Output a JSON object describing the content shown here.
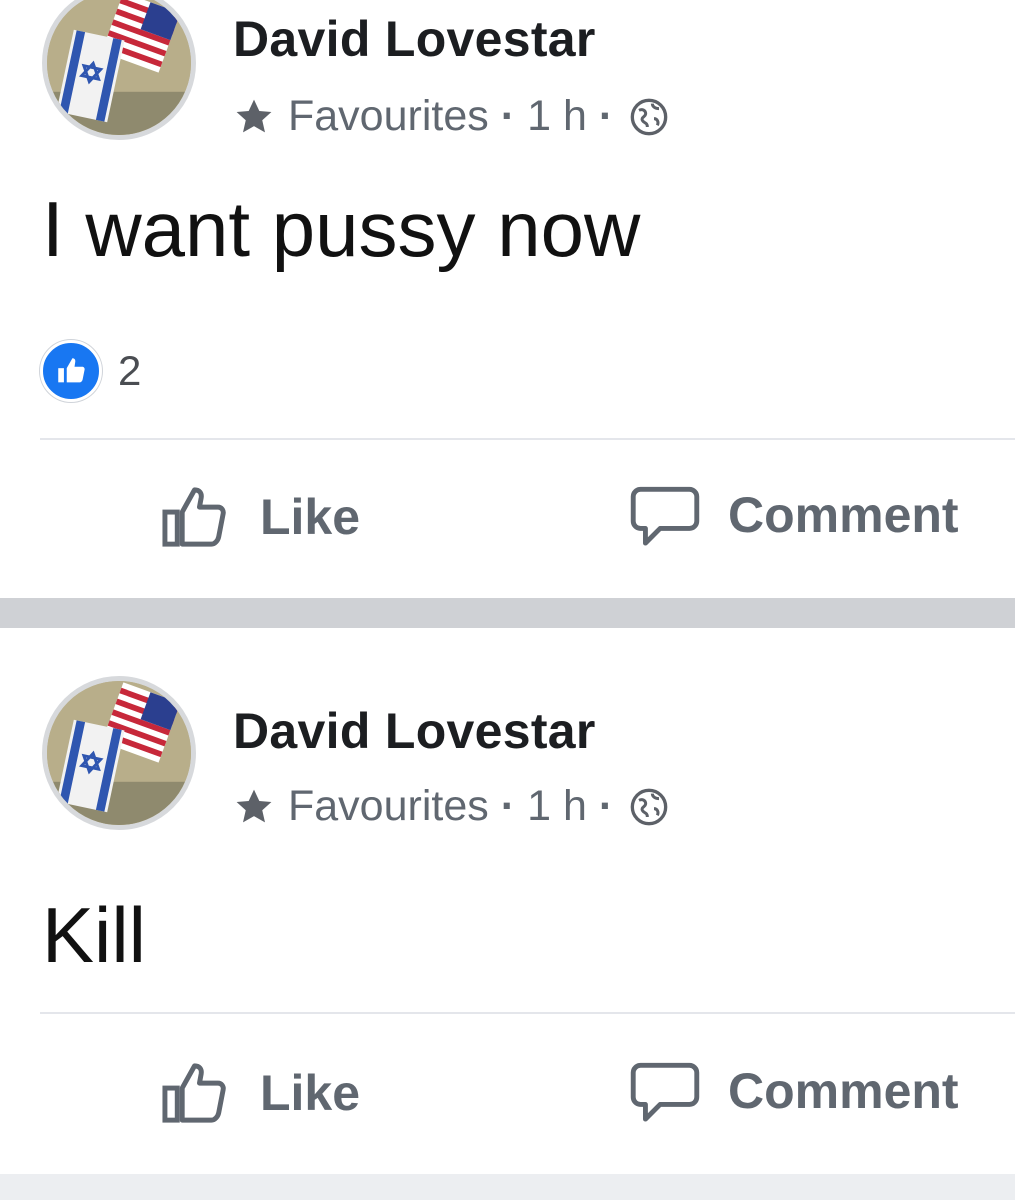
{
  "posts": [
    {
      "author": "David Lovestar",
      "audience": "Favourites",
      "separator": "·",
      "time": "1 h",
      "text": "I want pussy now",
      "reaction_count": "2",
      "actions": {
        "like": "Like",
        "comment": "Comment"
      }
    },
    {
      "author": "David Lovestar",
      "audience": "Favourites",
      "separator": "·",
      "time": "1 h",
      "text": "Kill",
      "actions": {
        "like": "Like",
        "comment": "Comment"
      }
    }
  ],
  "icons": {
    "star": "star-icon",
    "globe": "globe-icon",
    "like_reaction": "like-reaction-icon",
    "like_action": "thumbs-up-icon",
    "comment_action": "comment-icon"
  },
  "colors": {
    "reaction_blue": "#1877f2",
    "meta_gray": "#606770",
    "feed_separator": "#cfd1d5"
  }
}
